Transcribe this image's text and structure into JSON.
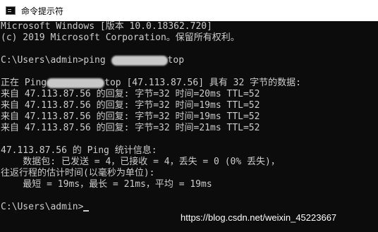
{
  "window": {
    "title": "命令提示符",
    "icon": "cmd-console-icon"
  },
  "console": {
    "banner_line1": "Microsoft Windows [版本 10.0.18362.720]",
    "banner_line2": "(c) 2019 Microsoft Corporation。保留所有权利。",
    "command_prefix": "C:\\Users\\admin>ping ",
    "command_suffix": "top",
    "ping_header_prefix": "正在 Ping",
    "ping_header_suffix": "top [47.113.87.56] 具有 32 字节的数据:",
    "replies": [
      "来自 47.113.87.56 的回复: 字节=32 时间=20ms TTL=52",
      "来自 47.113.87.56 的回复: 字节=32 时间=19ms TTL=52",
      "来自 47.113.87.56 的回复: 字节=32 时间=19ms TTL=52",
      "来自 47.113.87.56 的回复: 字节=32 时间=21ms TTL=52"
    ],
    "stats_header": "47.113.87.56 的 Ping 统计信息:",
    "stats_packets": "    数据包: 已发送 = 4，已接收 = 4，丢失 = 0 (0% 丢失)，",
    "stats_rtt_header": "往返行程的估计时间(以毫秒为单位):",
    "stats_rtt_values": "    最短 = 19ms，最长 = 21ms，平均 = 19ms",
    "prompt": "C:\\Users\\admin>"
  },
  "watermark": "https://blog.csdn.net/weixin_45223667",
  "colors": {
    "console_bg": "#0c0c0c",
    "console_text": "#cccccc",
    "titlebar_bg": "#ffffff"
  }
}
